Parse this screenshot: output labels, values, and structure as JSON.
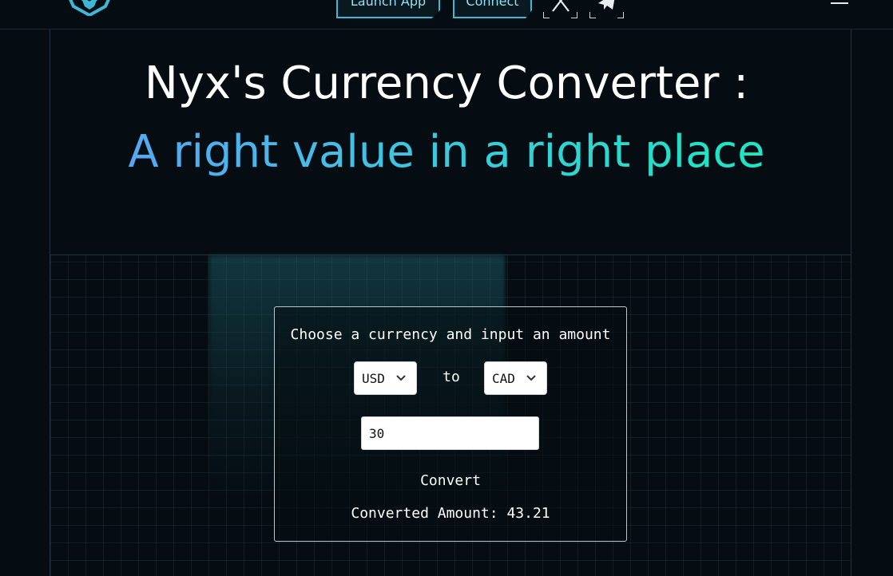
{
  "header": {
    "launch_label": "Launch App",
    "connect_label": "Connect",
    "social": [
      {
        "icon": "x-icon"
      },
      {
        "icon": "telegram-icon"
      }
    ],
    "menu_icon": "hamburger-menu-icon"
  },
  "hero": {
    "title": "Nyx's Currency Converter :",
    "subtitle": "A right value in a right place"
  },
  "converter": {
    "heading": "Choose a currency and input an amount",
    "from_currency": "USD",
    "to_label": "to",
    "to_currency": "CAD",
    "amount": "30",
    "convert_label": "Convert",
    "result_text": "Converted Amount: 43.21"
  },
  "colors": {
    "background": "#050d12",
    "accent": "#3fb8d8",
    "gradient_start": "#58a6f2",
    "gradient_end": "#1de6c1"
  }
}
